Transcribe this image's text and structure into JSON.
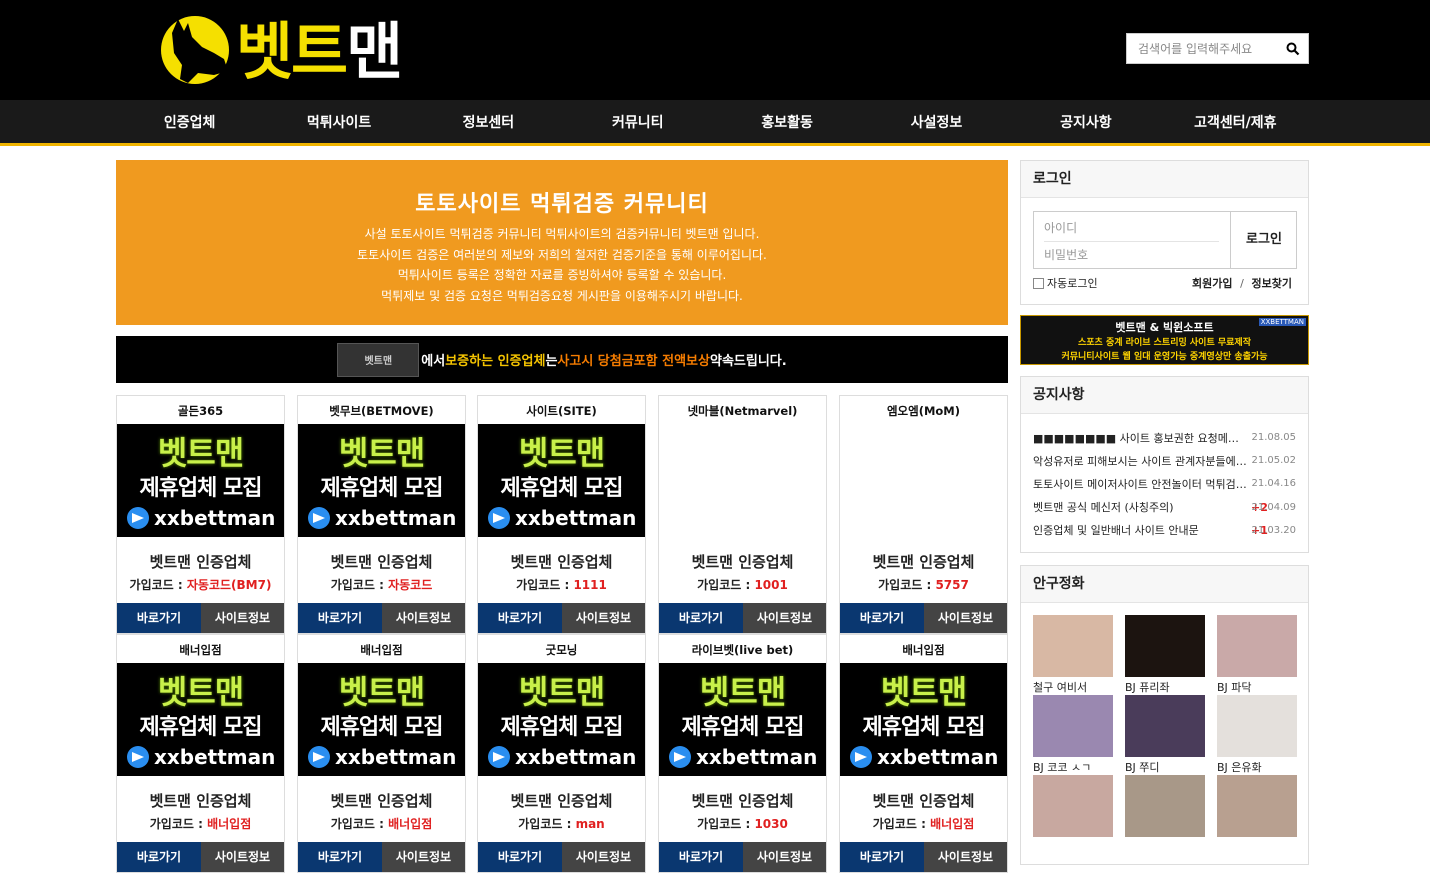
{
  "header": {
    "logo_text_a": "벳트",
    "logo_text_b": "맨",
    "search_placeholder": "검색어를 입력해주세요"
  },
  "nav": [
    "인증업체",
    "먹튀사이트",
    "정보센터",
    "커뮤니티",
    "홍보활동",
    "사설정보",
    "공지사항",
    "고객센터/제휴"
  ],
  "hero": {
    "title": "토토사이트 먹튀검증 커뮤니티",
    "lines": [
      "사설 토토사이트 먹튀검증 커뮤니티 먹튀사이트의 검증커뮤니티 벳트맨 입니다.",
      "토토사이트 검증은 여러분의 제보와 저희의 철저한 검증기준을 통해 이루어집니다.",
      "먹튀사이트 등록은 정확한 자료를 증빙하셔야 등록할 수 있습니다.",
      "먹튀제보 및 검증 요청은 먹튀검증요청 게시판을 이용해주시기 바랍니다."
    ]
  },
  "notice_bar": {
    "logo_label": "벳트맨",
    "p1": "에서",
    "p2": "보증하는 인증업체",
    "p3": "는",
    "p4": "사고시 당첨금포함 전액보상",
    "p5": "약속드립니다."
  },
  "card_common": {
    "name": "벳트맨 인증업체",
    "code_label": "가입코드 : ",
    "btn_go": "바로가기",
    "btn_info": "사이트정보",
    "img_l1": "벳트맨",
    "img_l2": "제휴업체 모집",
    "img_l3": "xxbettman"
  },
  "cards": [
    {
      "title": "골든365",
      "code": "자동코드(BM7)"
    },
    {
      "title": "벳무브(BETMOVE)",
      "code": "자동코드"
    },
    {
      "title": "사이트(SITE)",
      "code": "1111"
    },
    {
      "title": "넷마블(Netmarvel)",
      "code": "1001"
    },
    {
      "title": "엠오엠(MoM)",
      "code": "5757"
    },
    {
      "title": "배너입점",
      "code": "배너입점"
    },
    {
      "title": "배너입점",
      "code": "배너입점"
    },
    {
      "title": "굿모닝",
      "code": "man"
    },
    {
      "title": "라이브벳(live bet)",
      "code": "1030"
    },
    {
      "title": "배너입점",
      "code": "배너입점"
    }
  ],
  "login": {
    "title": "로그인",
    "id_placeholder": "아이디",
    "pw_placeholder": "비밀번호",
    "btn": "로그인",
    "auto": "자동로그인",
    "join": "회원가입",
    "sep": "/",
    "find": "정보찾기"
  },
  "ad": {
    "l1": "벳트맨 & 빅윈소프트",
    "l2": "스포츠 중계 라이브 스트리밍 사이트 무료제작",
    "l3": "커뮤니티사이트 웹 임대 운영가능 중계영상만 송출가능",
    "tag": "XXBETTMAN"
  },
  "notices": {
    "title": "공지사항",
    "items": [
      {
        "text": "■■■■■■■■ 사이트 홍보권한 요청메뉴 안내",
        "count": "",
        "date": "21.08.05"
      },
      {
        "text": "악성유저로 피해보시는 사이트 관계자분들에게 알립니다",
        "count": "",
        "date": "21.05.02"
      },
      {
        "text": "토토사이트 메이저사이트 안전놀이터 먹튀검증 커뮤니티",
        "count": "",
        "date": "21.04.16"
      },
      {
        "text": "벳트맨 공식 메신저 (사칭주의)",
        "count": "+2",
        "date": "21.04.09"
      },
      {
        "text": "인증업체 및 일반배너 사이트 안내문",
        "count": "+1",
        "date": "21.03.20"
      }
    ]
  },
  "gallery": {
    "title": "안구정화",
    "items": [
      {
        "label": "철구 여비서",
        "color": "#d8b8a4"
      },
      {
        "label": "BJ 퓨리좌",
        "color": "#1c1410"
      },
      {
        "label": "BJ 파닥",
        "color": "#c9a9a8"
      },
      {
        "label": "BJ 코코 ㅅㄱ",
        "color": "#9a88b0"
      },
      {
        "label": "BJ 쭈디",
        "color": "#4a3c5a"
      },
      {
        "label": "BJ 은유화",
        "color": "#e4e0dc"
      },
      {
        "label": "",
        "color": "#c8a8a0"
      },
      {
        "label": "",
        "color": "#a89888"
      },
      {
        "label": "",
        "color": "#b8a090"
      }
    ]
  }
}
